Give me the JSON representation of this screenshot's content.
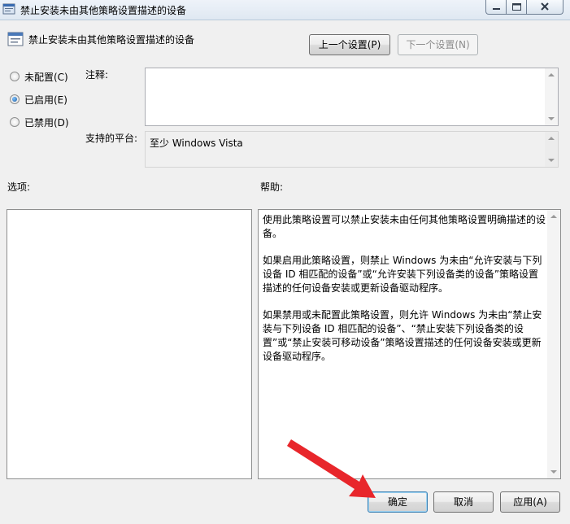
{
  "window": {
    "title": "禁止安装未由其他策略设置描述的设备"
  },
  "header": {
    "policy_title": "禁止安装未由其他策略设置描述的设备",
    "prev_button": "上一个设置(P)",
    "next_button": "下一个设置(N)"
  },
  "state_options": [
    {
      "label": "未配置(C)",
      "checked": false
    },
    {
      "label": "已启用(E)",
      "checked": true
    },
    {
      "label": "已禁用(D)",
      "checked": false
    }
  ],
  "comment": {
    "label": "注释:",
    "value": ""
  },
  "platform": {
    "label": "支持的平台:",
    "value": "至少 Windows Vista"
  },
  "options": {
    "label": "选项:"
  },
  "help": {
    "label": "帮助:",
    "paragraphs": [
      "使用此策略设置可以禁止安装未由任何其他策略设置明确描述的设备。",
      "如果启用此策略设置，则禁止 Windows 为未由“允许安装与下列设备 ID 相匹配的设备”或“允许安装下列设备类的设备”策略设置描述的任何设备安装或更新设备驱动程序。",
      "如果禁用或未配置此策略设置，则允许 Windows 为未由“禁止安装与下列设备 ID 相匹配的设备”、“禁止安装下列设备类的设置”或“禁止安装可移动设备”策略设置描述的任何设备安装或更新设备驱动程序。"
    ]
  },
  "footer": {
    "ok": "确定",
    "cancel": "取消",
    "apply": "应用(A)"
  },
  "annotation": {
    "arrow_color": "#e8262b"
  }
}
